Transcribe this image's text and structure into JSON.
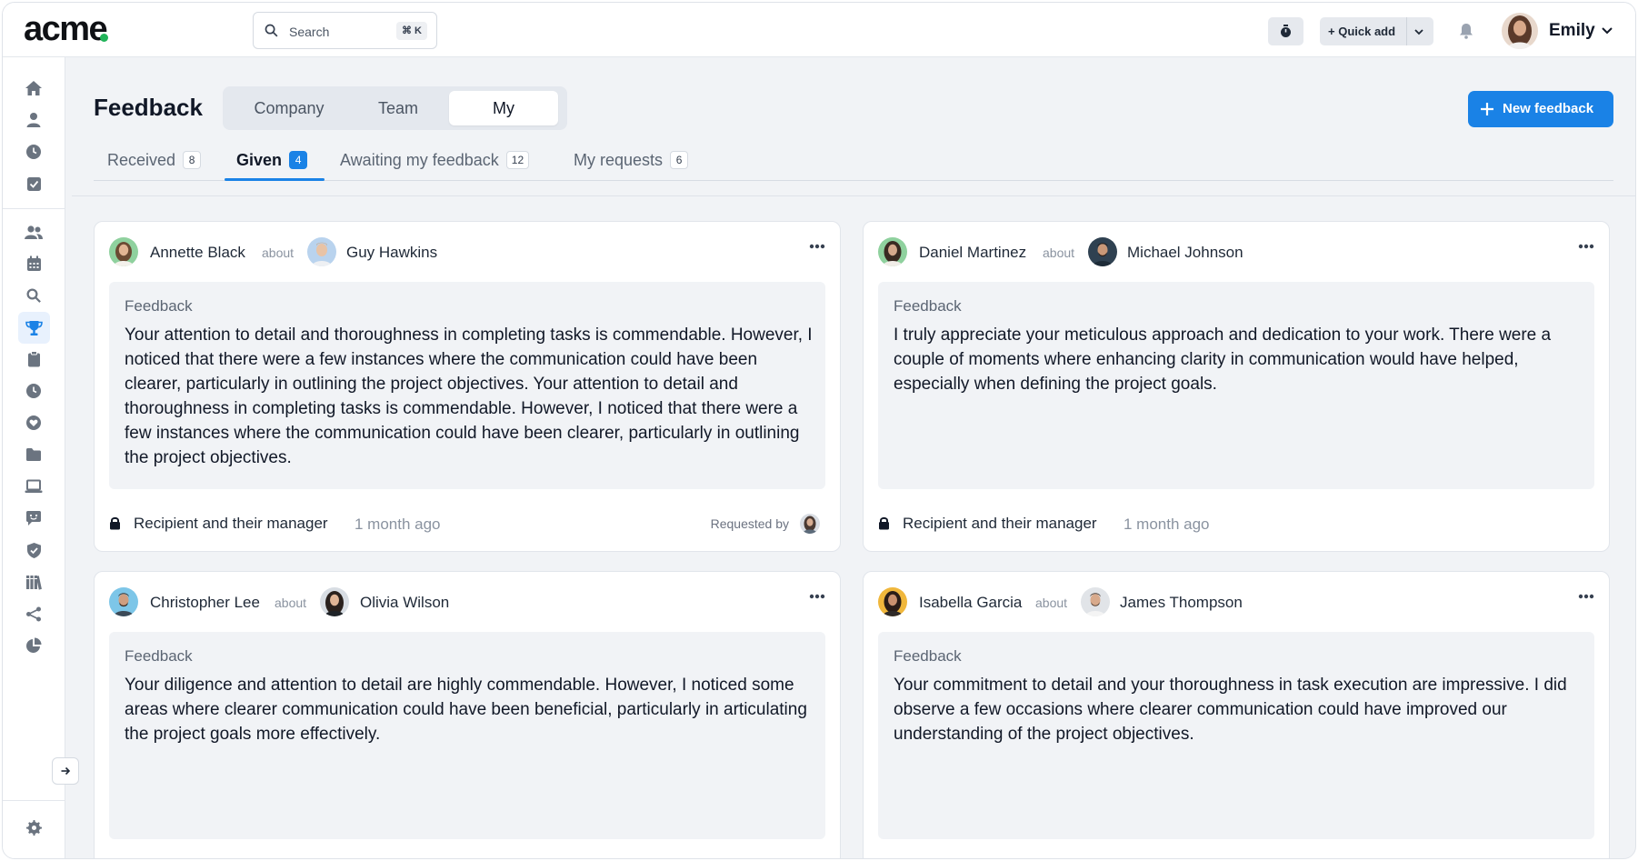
{
  "app": {
    "logo": "acme"
  },
  "search": {
    "placeholder": "Search",
    "shortcut": "⌘ K"
  },
  "topbar": {
    "quick_add_label": "Quick add",
    "user_name": "Emily"
  },
  "page": {
    "title": "Feedback",
    "scopes": [
      "Company",
      "Team",
      "My"
    ],
    "selected_scope": "My",
    "new_button_label": "New feedback"
  },
  "tabs": [
    {
      "label": "Received",
      "count": "8"
    },
    {
      "label": "Given",
      "count": "4"
    },
    {
      "label": "Awaiting my feedback",
      "count": "12"
    },
    {
      "label": "My requests",
      "count": "6"
    }
  ],
  "selected_tab": "Given",
  "cards": [
    {
      "author": "Annette Black",
      "about_word": "about",
      "recipient": "Guy Hawkins",
      "label": "Feedback",
      "text": "Your attention to detail and thoroughness in completing tasks is commendable. However, I noticed that there were a few instances where the communication could have been clearer, particularly in outlining the project objectives. Your attention to detail and thoroughness in completing tasks is commendable. However, I noticed that there were a few instances where the communication could have been clearer, particularly in outlining the project objectives.",
      "visibility": "Recipient and their manager",
      "time": "1 month ago",
      "requested_by": "Requested by"
    },
    {
      "author": "Daniel Martinez",
      "about_word": "about",
      "recipient": "Michael Johnson",
      "label": "Feedback",
      "text": "I truly appreciate your meticulous approach and dedication to your work. There were a couple of moments where enhancing clarity in communication would have helped, especially when defining the project goals.",
      "visibility": "Recipient and their manager",
      "time": "1 month ago"
    },
    {
      "author": "Christopher Lee",
      "about_word": "about",
      "recipient": "Olivia Wilson",
      "label": "Feedback",
      "text": "Your diligence and attention to detail are highly commendable. However, I noticed some areas where clearer communication could have been beneficial, particularly in articulating the project goals more effectively."
    },
    {
      "author": "Isabella Garcia",
      "about_word": "about",
      "recipient": "James Thompson",
      "label": "Feedback",
      "text": "Your commitment to detail and your thoroughness in task execution are impressive. I did observe a few occasions where clearer communication could have improved our understanding of the project objectives."
    }
  ],
  "sidebar": {
    "icons": [
      "home-icon",
      "person-icon",
      "clock-icon",
      "checkbox-icon",
      "people-icon",
      "calendar-icon",
      "search-icon",
      "trophy-icon",
      "clipboard-icon",
      "time-icon",
      "heart-icon",
      "folder-icon",
      "laptop-icon",
      "chat-icon",
      "shield-icon",
      "library-icon",
      "share-icon",
      "pie-chart-icon",
      "gear-icon",
      "expand-arrow-icon"
    ],
    "active": "trophy-icon"
  },
  "colors": {
    "accent": "#1a82e6",
    "logo_dot": "#22b45a",
    "active_nav_bg": "#e8f1fd"
  }
}
